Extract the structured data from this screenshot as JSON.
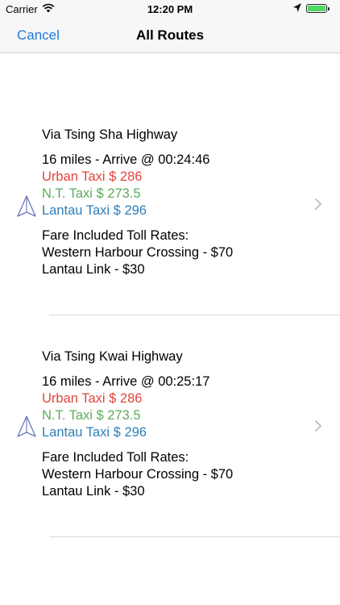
{
  "status_bar": {
    "carrier": "Carrier",
    "time": "12:20 PM",
    "battery_level": 1.0
  },
  "nav": {
    "cancel_label": "Cancel",
    "title": "All Routes"
  },
  "routes": [
    {
      "name": "Via Tsing Sha Highway",
      "distance_eta": "16 miles - Arrive @ 00:24:46",
      "urban_fare": "Urban Taxi $ 286",
      "nt_fare": "N.T. Taxi $ 273.5",
      "lantau_fare": "Lantau Taxi $ 296",
      "toll_header": "Fare Included Toll Rates:",
      "tolls": [
        "Western Harbour Crossing - $70",
        "Lantau Link - $30"
      ]
    },
    {
      "name": "Via Tsing Kwai Highway",
      "distance_eta": "16 miles - Arrive @ 00:25:17",
      "urban_fare": "Urban Taxi $ 286",
      "nt_fare": "N.T. Taxi $ 273.5",
      "lantau_fare": "Lantau Taxi $ 296",
      "toll_header": "Fare Included Toll Rates:",
      "tolls": [
        "Western Harbour Crossing - $70",
        "Lantau Link - $30"
      ]
    }
  ],
  "colors": {
    "accent": "#1a7ad9",
    "urban": "#e0443a",
    "nt": "#5bab5c",
    "lantau": "#2f7fb7"
  }
}
